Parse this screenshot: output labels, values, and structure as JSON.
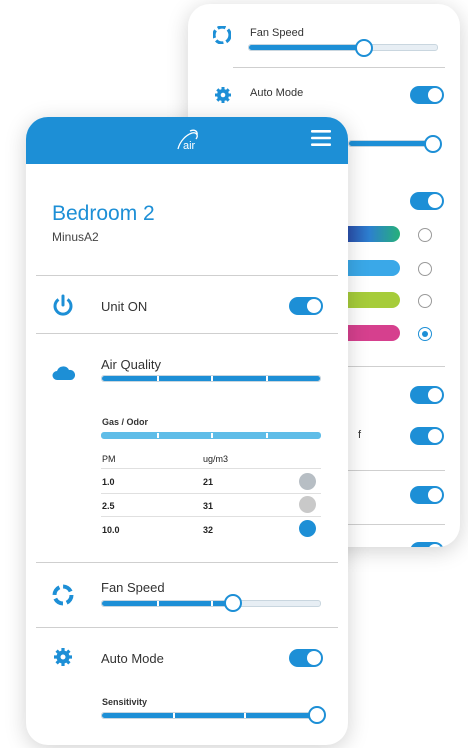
{
  "back_panel": {
    "fan_speed_label": "Fan Speed",
    "fan_speed_level": 0.7,
    "auto_mode_label": "Auto Mode",
    "auto_mode_on": true,
    "sensitivity_level": 1.0,
    "color_options": [
      {
        "name": "gradient",
        "selected": false
      },
      {
        "name": "blue",
        "selected": false
      },
      {
        "name": "green",
        "selected": false
      },
      {
        "name": "pink",
        "selected": true
      }
    ],
    "colors": {
      "blue": "#3aa8e8",
      "green": "#a6cc3a",
      "pink": "#d6408e"
    },
    "partial_text": "f"
  },
  "front": {
    "logo_text": "air",
    "room_title": "Bedroom 2",
    "room_subtitle": "MinusA2",
    "unit_label": "Unit ON",
    "unit_on": true,
    "air_quality_label": "Air Quality",
    "gas_label": "Gas / Odor",
    "table": {
      "headers": [
        "PM",
        "ug/m3"
      ],
      "rows": [
        {
          "pm": "1.0",
          "value": "21",
          "status_color": "#b7bec4"
        },
        {
          "pm": "2.5",
          "value": "31",
          "status_color": "#c9c9c9"
        },
        {
          "pm": "10.0",
          "value": "32",
          "status_color": "#1d8fd6"
        }
      ]
    },
    "fan_speed_label": "Fan Speed",
    "fan_speed_level": 0.6,
    "auto_mode_label": "Auto Mode",
    "auto_mode_on": true,
    "sensitivity_label": "Sensitivity",
    "sensitivity_level": 1.0
  },
  "accent_color": "#1d8fd6"
}
